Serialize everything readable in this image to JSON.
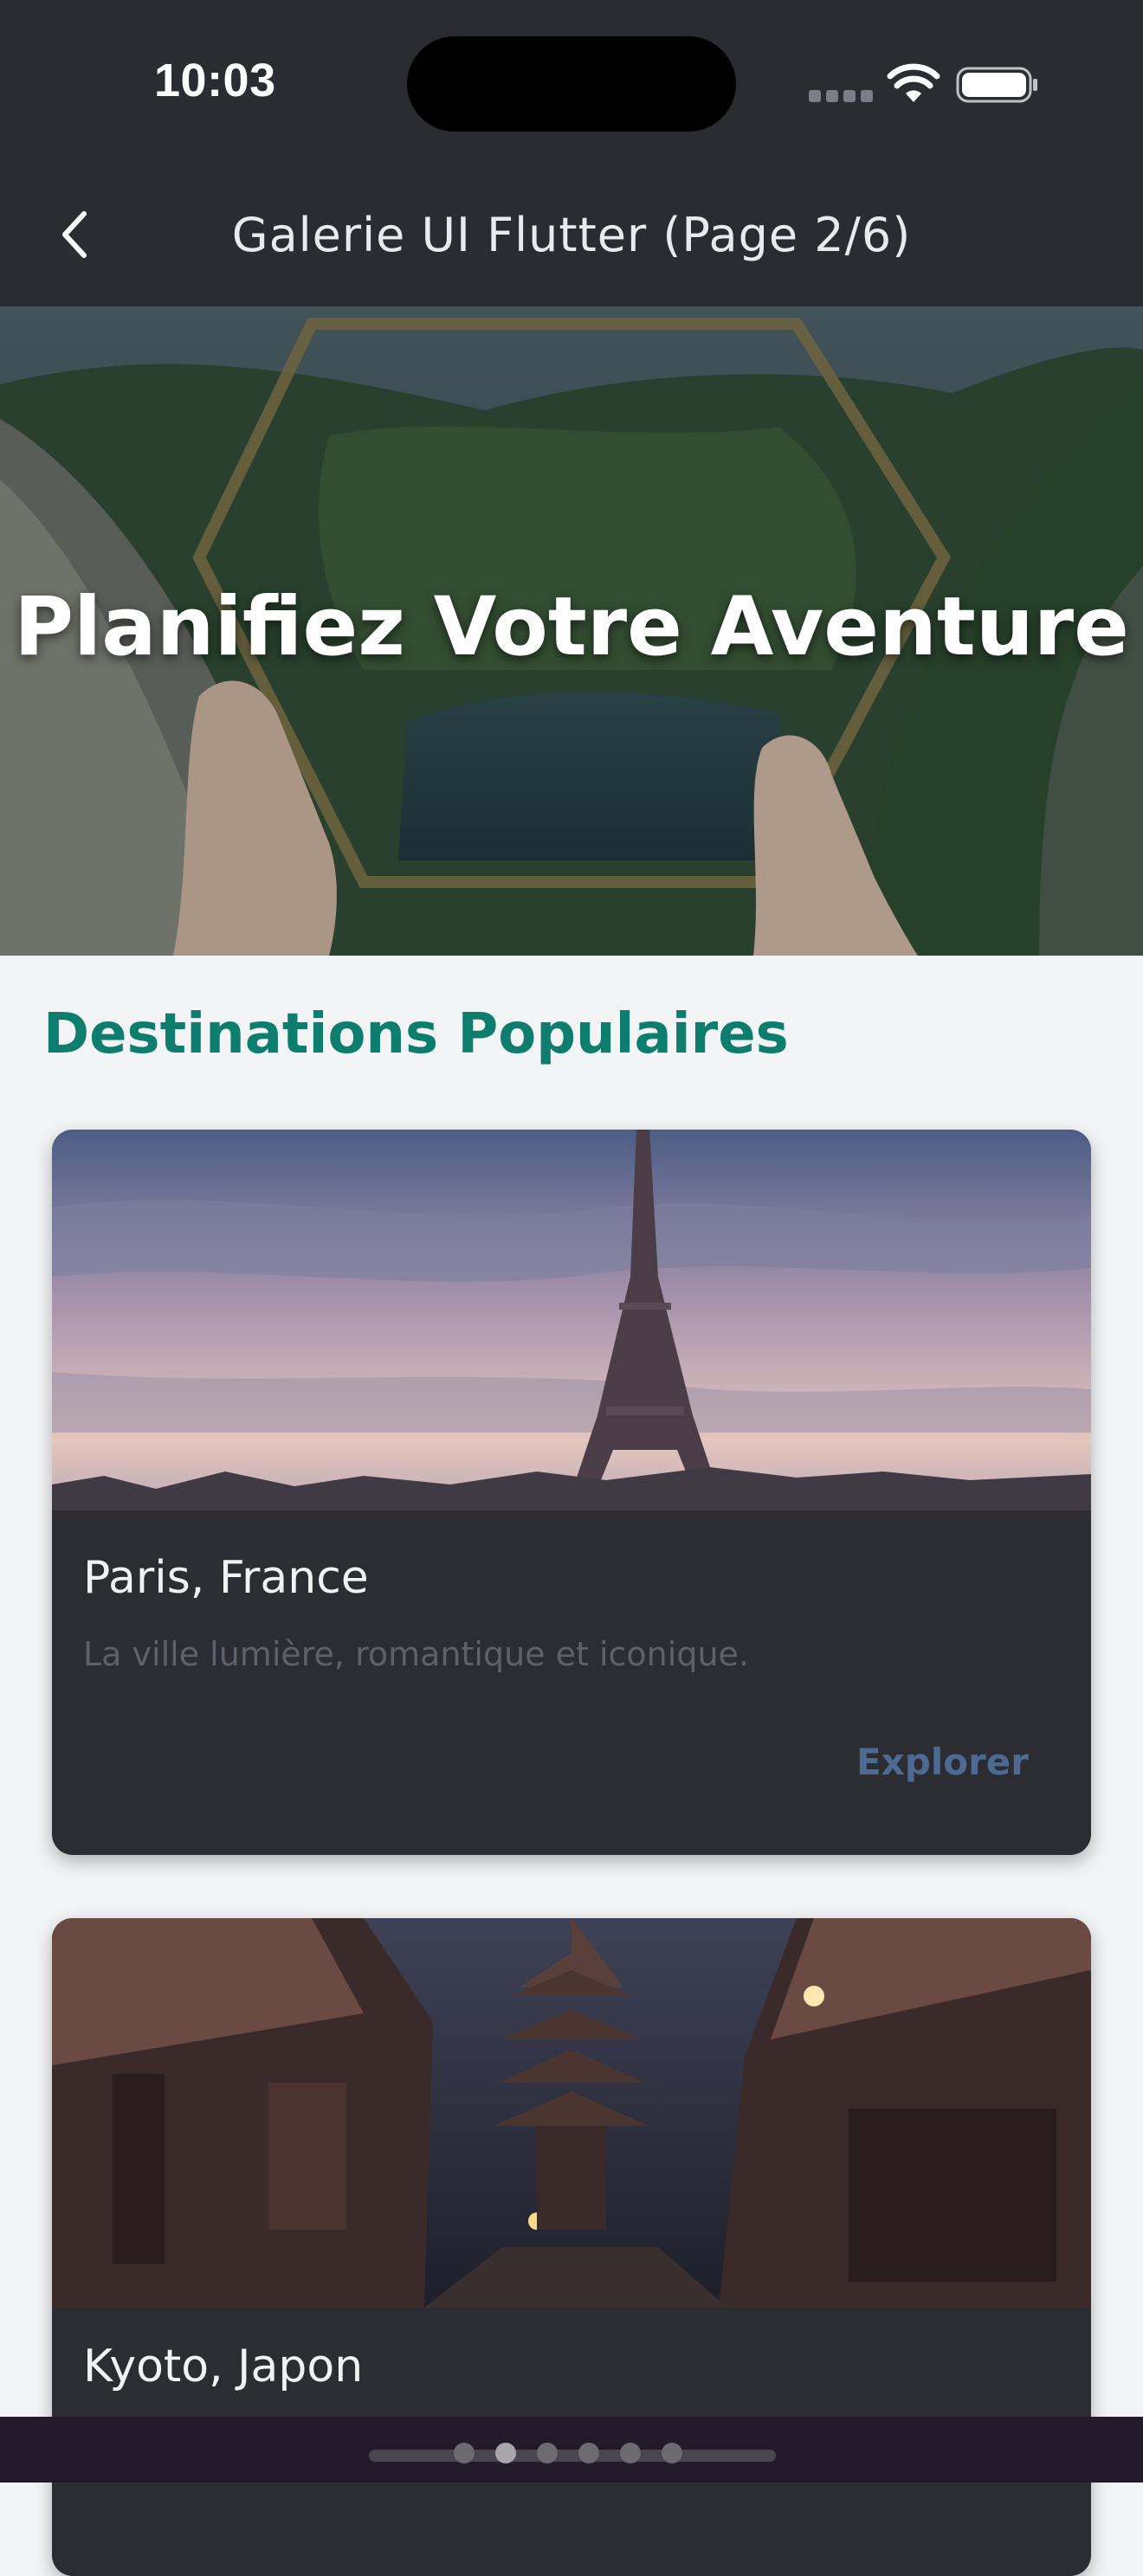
{
  "status_bar": {
    "time": "10:03",
    "icons": [
      "signal-icon",
      "wifi-icon",
      "battery-icon"
    ]
  },
  "app_bar": {
    "back_icon": "chevron-left-icon",
    "title": "Galerie UI Flutter (Page 2/6)"
  },
  "hero": {
    "title": "Planifiez Votre Aventure"
  },
  "section": {
    "title": "Destinations Populaires"
  },
  "destinations": [
    {
      "title": "Paris, France",
      "description": "La ville lumière, romantique et iconique.",
      "action": "Explorer"
    },
    {
      "title": "Kyoto, Japon"
    }
  ],
  "pagination": {
    "total": 6,
    "current": 2
  },
  "colors": {
    "app_bar": "#2a2c31",
    "section_title": "#0d7d6d",
    "card_background": "#2b2d32",
    "action_text": "#4d6a92",
    "page_background": "#f3f4f6"
  }
}
